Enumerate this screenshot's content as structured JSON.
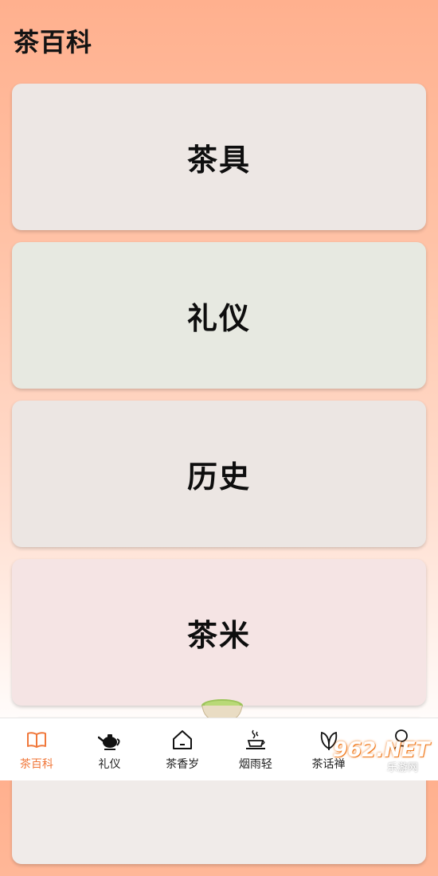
{
  "header": {
    "title": "茶百科"
  },
  "cards": [
    {
      "label": "茶具"
    },
    {
      "label": "礼仪"
    },
    {
      "label": "历史"
    },
    {
      "label": "茶米"
    },
    {
      "label": ""
    }
  ],
  "nav": {
    "items": [
      {
        "label": "茶百科",
        "icon": "book-icon",
        "active": true
      },
      {
        "label": "礼仪",
        "icon": "teapot-icon",
        "active": false
      },
      {
        "label": "茶香岁",
        "icon": "home-icon",
        "active": false
      },
      {
        "label": "烟雨轻",
        "icon": "steaming-cup-icon",
        "active": false
      },
      {
        "label": "茶话禅",
        "icon": "leaf-icon",
        "active": false
      },
      {
        "label": "",
        "icon": "user-icon",
        "active": false
      }
    ],
    "active_color": "#f0773a"
  },
  "watermark": {
    "text_main": "962.NET",
    "text_sub": "乐游网"
  }
}
